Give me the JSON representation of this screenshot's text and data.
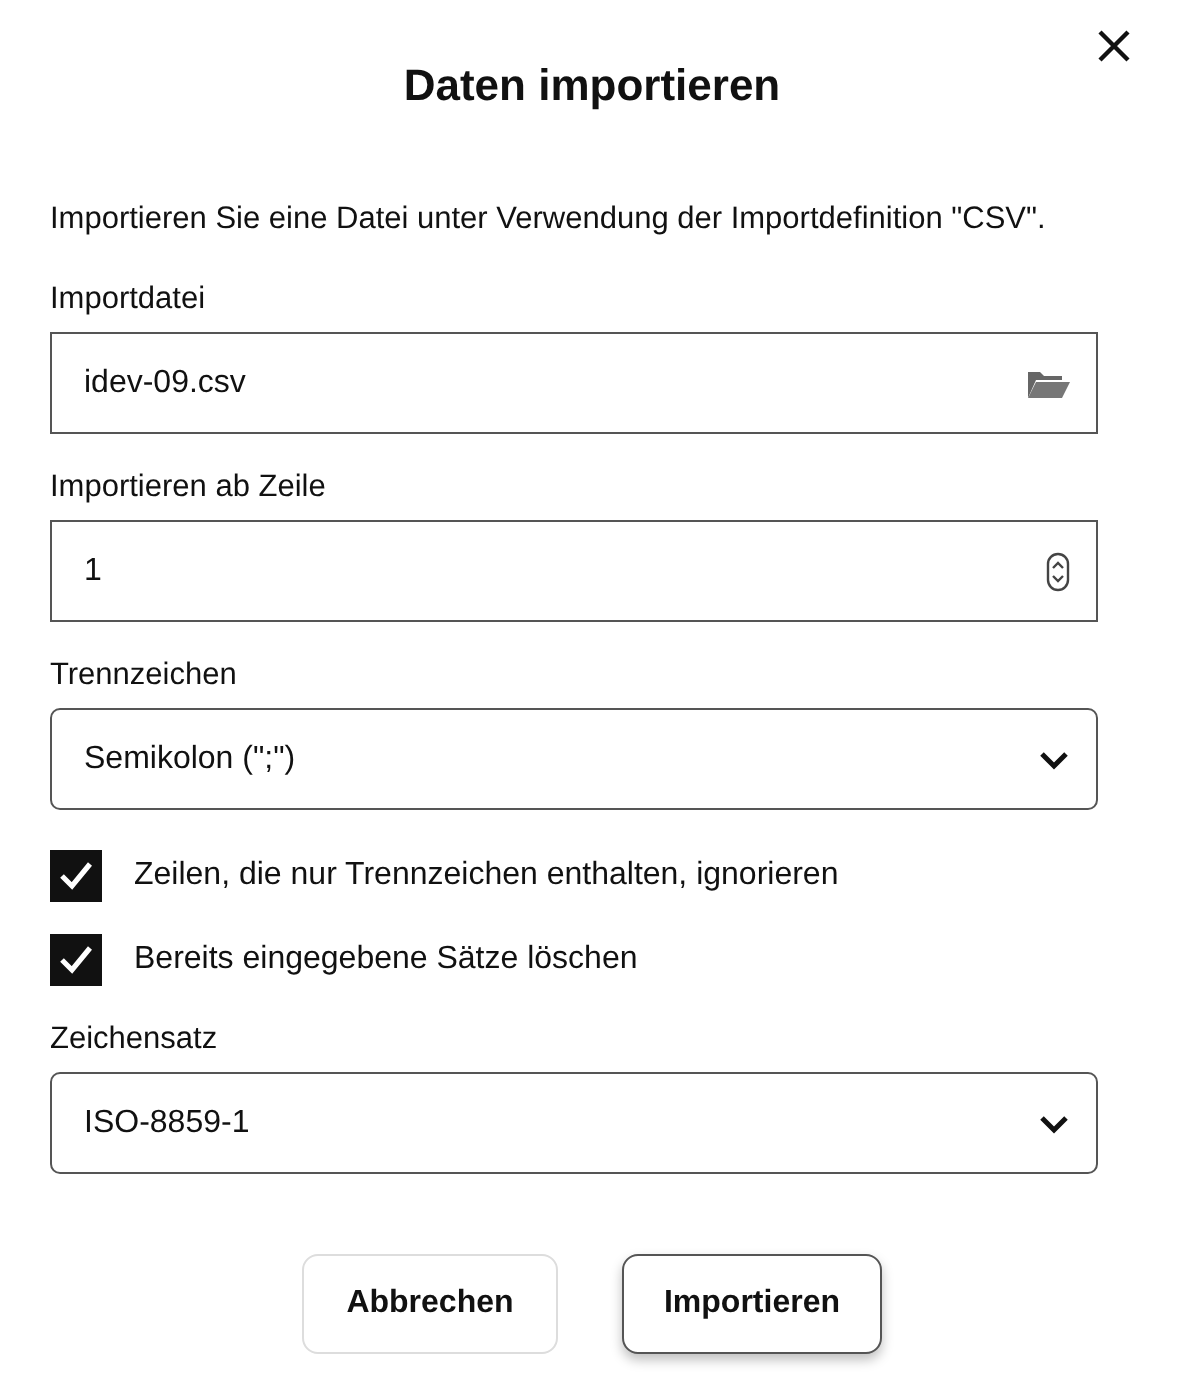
{
  "dialog": {
    "title": "Daten importieren",
    "description": "Importieren Sie eine Datei unter Verwendung der Importdefinition \"CSV\"."
  },
  "form": [
    {
      "kind": "file",
      "label": "Importdatei",
      "value": "idev-09.csv"
    },
    {
      "kind": "number",
      "label": "Importieren ab Zeile",
      "value": "1"
    },
    {
      "kind": "select",
      "label": "Trennzeichen",
      "value": "Semikolon (\";\")"
    },
    {
      "kind": "checkbox",
      "label": "Zeilen, die nur Trennzeichen enthalten, ignorieren",
      "checked": true
    },
    {
      "kind": "checkbox",
      "label": "Bereits eingegebene Sätze löschen",
      "checked": true
    },
    {
      "kind": "select",
      "label": "Zeichensatz",
      "value": "ISO-8859-1"
    }
  ],
  "buttons": [
    {
      "label": "Abbrechen",
      "hovered": false
    },
    {
      "label": "Importieren",
      "hovered": true
    }
  ]
}
